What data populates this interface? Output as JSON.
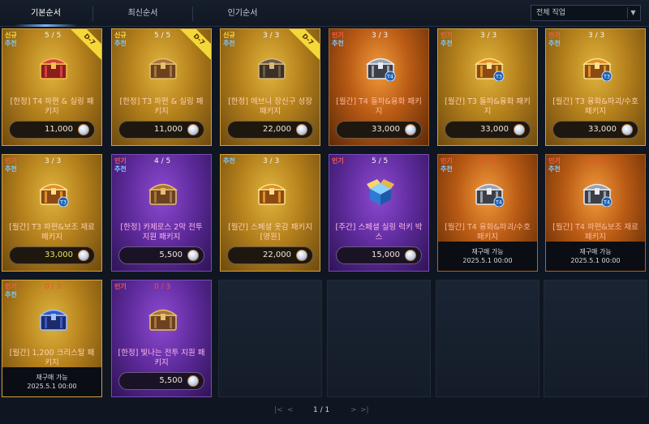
{
  "tabs": [
    {
      "label": "기본순서",
      "active": true
    },
    {
      "label": "최신순서",
      "active": false
    },
    {
      "label": "인기순서",
      "active": false
    }
  ],
  "job_filter": {
    "value": "전체 직업"
  },
  "cards": [
    {
      "tag1": "신규",
      "tag1_type": "new",
      "tag2": "추천",
      "count": "5 / 5",
      "ribbon": "D-7",
      "theme": "gold",
      "chest": "red",
      "title": "[한정] T4 파편 & 실링 패키지",
      "price": "11,000",
      "price_yellow": false
    },
    {
      "tag1": "신규",
      "tag1_type": "new",
      "tag2": "추천",
      "count": "5 / 5",
      "ribbon": "D-7",
      "theme": "gold",
      "chest": "brown",
      "title": "[한정] T3 파편 & 실링 패키지",
      "price": "11,000",
      "price_yellow": false
    },
    {
      "tag1": "신규",
      "tag1_type": "new",
      "tag2": "추천",
      "count": "3 / 3",
      "ribbon": "D-7",
      "theme": "gold",
      "chest": "dark",
      "title": "[한정] 에브니 장신구 성장 패키지",
      "price": "22,000",
      "price_yellow": false
    },
    {
      "tag1": "인기",
      "tag1_type": "pop",
      "tag2": "추천",
      "count": "3 / 3",
      "ribbon": "",
      "theme": "orange",
      "chest": "silver",
      "badge": "T4",
      "title": "[월간] T4 돌파&융화 패키지",
      "price": "33,000",
      "price_yellow": false
    },
    {
      "tag1": "인기",
      "tag1_type": "pop",
      "tag2": "추천",
      "count": "3 / 3",
      "ribbon": "",
      "theme": "gold",
      "chest": "gold",
      "badge": "T3",
      "title": "[월간] T3 돌파&융화 패키지",
      "price": "33,000",
      "price_yellow": false
    },
    {
      "tag1": "인기",
      "tag1_type": "pop",
      "tag2": "추천",
      "count": "3 / 3",
      "ribbon": "",
      "theme": "gold",
      "chest": "gold",
      "badge": "T3",
      "title": "[월간] T3 융화&파괴/수호 패키지",
      "price": "33,000",
      "price_yellow": false
    },
    {
      "tag1": "인기",
      "tag1_type": "pop",
      "tag2": "추천",
      "count": "3 / 3",
      "ribbon": "",
      "theme": "gold",
      "chest": "gold",
      "badge": "T3",
      "title": "[월간] T3 파편&보조 재료 패키지",
      "price": "33,000",
      "price_yellow": true
    },
    {
      "tag1": "인기",
      "tag1_type": "pop",
      "tag2": "추천",
      "count": "4 / 5",
      "ribbon": "",
      "theme": "purple",
      "chest": "brown",
      "title": "[한정] 카제로스 2막 전투 지원 패키지",
      "price": "5,500",
      "price_yellow": false
    },
    {
      "tag1": "",
      "tag1_type": "",
      "tag2": "추천",
      "count": "3 / 3",
      "ribbon": "",
      "theme": "gold",
      "chest": "gold",
      "title": "[월간] 스페셜 옷감 패키지 [영원]",
      "price": "22,000",
      "price_yellow": false
    },
    {
      "tag1": "인기",
      "tag1_type": "pop",
      "tag2": "",
      "count": "5 / 5",
      "ribbon": "",
      "theme": "purple",
      "chest": "box",
      "title": "[주간] 스페셜 실링 럭키 박스",
      "price": "15,000",
      "price_yellow": false
    },
    {
      "tag1": "인기",
      "tag1_type": "pop",
      "tag2": "추천",
      "count": "0 / 3",
      "soldout": true,
      "theme": "orange",
      "chest": "silver",
      "badge": "T4",
      "title": "[월간] T4 융화&파괴/수호 패키지",
      "restock": "재구매 가능",
      "restock_date": "2025.5.1 00:00"
    },
    {
      "tag1": "인기",
      "tag1_type": "pop",
      "tag2": "추천",
      "count": "0 / 3",
      "soldout": true,
      "theme": "orange",
      "chest": "silver",
      "badge": "T4",
      "title": "[월간] T4 파편&보조 재료 패키지",
      "restock": "재구매 가능",
      "restock_date": "2025.5.1 00:00"
    },
    {
      "tag1": "인기",
      "tag1_type": "pop",
      "tag2": "추천",
      "count": "0 / 3",
      "soldout": true,
      "theme": "gold",
      "chest": "blue",
      "title": "[월간] 1,200 크리스탈 패키지",
      "restock": "재구매 가능",
      "restock_date": "2025.5.1 00:00"
    },
    {
      "tag1": "인기",
      "tag1_type": "pop",
      "tag2": "",
      "count": "0 / 3",
      "soldout_count": true,
      "theme": "purple",
      "chest": "brown",
      "title": "[한정] 빛나는 전투 지원 패키지",
      "price": "5,500",
      "price_yellow": false
    }
  ],
  "pager": {
    "text": "1 / 1",
    "first": "|<",
    "prev": "<",
    "next": ">",
    "last": ">|"
  }
}
